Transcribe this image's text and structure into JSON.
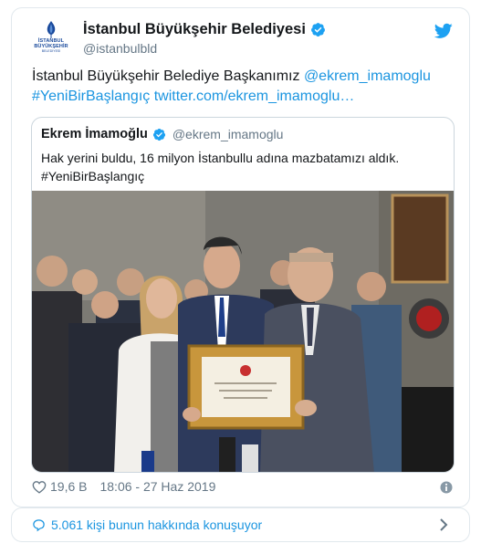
{
  "account": {
    "name": "İstanbul Büyükşehir Belediyesi",
    "handle": "@istanbulbld",
    "logo_text": "İSTANBUL BÜYÜKŞEHİR",
    "logo_sub": "BELEDİYESİ"
  },
  "tweet": {
    "text_plain": "İstanbul Büyükşehir Belediye Başkanımız",
    "mention": "@ekrem_imamoglu",
    "hashtag": "#YeniBirBaşlangıç",
    "link": "twitter.com/ekrem_imamoglu…"
  },
  "quote": {
    "name": "Ekrem İmamoğlu",
    "handle": "@ekrem_imamoglu",
    "text_line1": "Hak yerini buldu, 16 milyon İstanbullu adına mazbatamızı aldık.",
    "text_line2": "#YeniBirBaşlangıç"
  },
  "footer": {
    "likes": "19,6 B",
    "timestamp": "18:06 - 27 Haz 2019"
  },
  "conversation": {
    "label": "5.061 kişi bunun hakkında konuşuyor"
  },
  "icons": {
    "verified": "verified-badge-icon",
    "twitter": "twitter-bird-icon",
    "heart": "heart-icon",
    "info": "info-icon",
    "bubble": "speech-bubble-icon",
    "chevron": "chevron-right-icon"
  },
  "colors": {
    "link": "#1b95e0",
    "secondary_text": "#657786",
    "border": "#e1e8ed",
    "verified": "#1da1f2"
  }
}
